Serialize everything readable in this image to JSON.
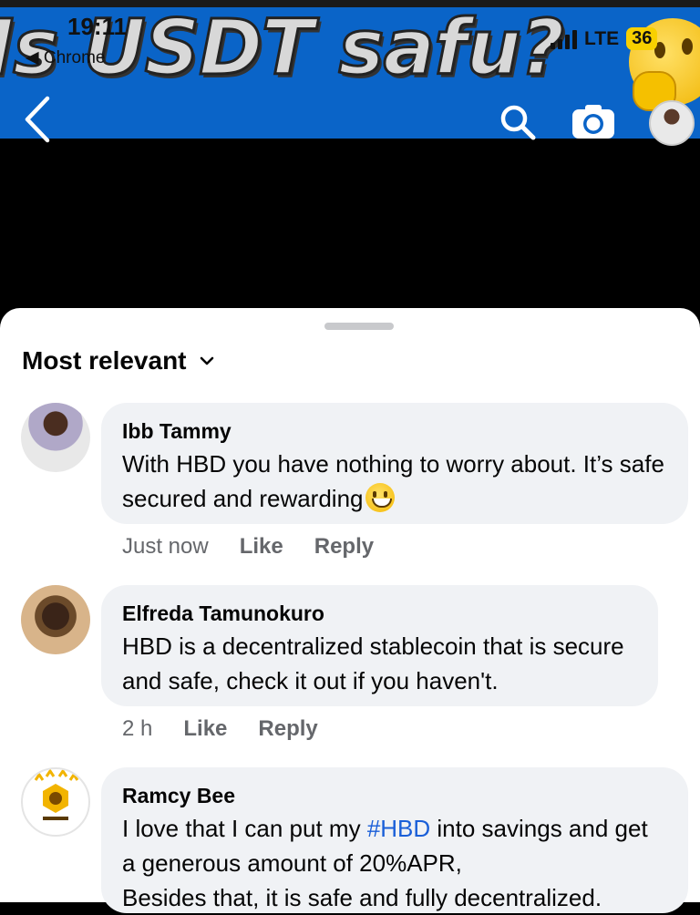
{
  "status_bar": {
    "time": "19:11",
    "back_app": "◀ Chrome",
    "network": "LTE",
    "battery": "36"
  },
  "hero": {
    "banner_text": "Is USDT safu?"
  },
  "sheet": {
    "sort_label": "Most relevant"
  },
  "comments": [
    {
      "name": "Ibb Tammy",
      "text": "With HBD you have nothing to worry about. It’s safe secured and rewarding",
      "time": "Just now",
      "like": "Like",
      "reply": "Reply"
    },
    {
      "name": "Elfreda Tamunokuro",
      "text": "HBD is a decentralized stablecoin that is secure and safe, check it out if you haven't.",
      "time": "2 h",
      "like": "Like",
      "reply": "Reply"
    },
    {
      "name": "Ramcy Bee",
      "text_before": "I love that I can put my ",
      "hashtag": "#HBD",
      "text_after": " into savings and get a generous amount of 20%APR,",
      "text_line2": "Besides that, it is safe and fully decentralized."
    }
  ],
  "colors": {
    "hero_blue": "#0a64c8",
    "bubble": "#f0f2f5",
    "meta_gray": "#65676b",
    "link_blue": "#1a5fd8"
  }
}
